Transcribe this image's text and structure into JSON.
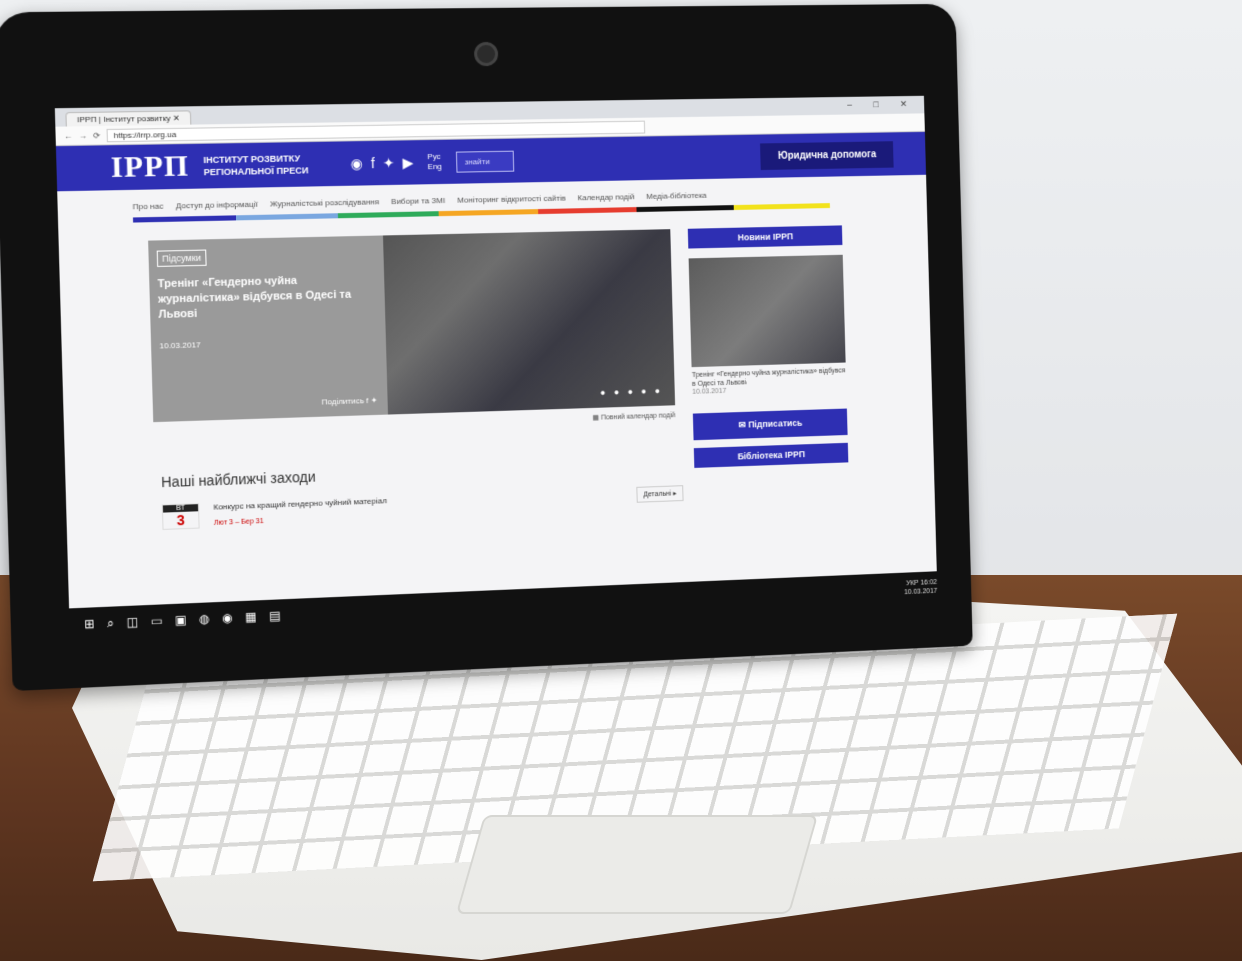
{
  "browser": {
    "tab_title": "ІРРП | Інститут розвитку",
    "url": "https://irrp.org.ua",
    "window_controls": "– □ ✕"
  },
  "header": {
    "logo": "ІРРП",
    "logo_text": "ІНСТИТУТ РОЗВИТКУ РЕГІОНАЛЬНОЇ ПРЕСИ",
    "lang_ru": "Рус",
    "lang_en": "Eng",
    "search_placeholder": "знайти",
    "legal_button": "Юридична допомога"
  },
  "nav": {
    "items": [
      "Про нас",
      "Доступ до інформації",
      "Журналістські розслідування",
      "Вибори та ЗМІ",
      "Моніторинг відкритості сайтів",
      "Календар подій",
      "Медіа-бібліотека"
    ],
    "colors": [
      "#2e2fb3",
      "#7aa7e0",
      "#2eab5a",
      "#f5a623",
      "#e63c2f",
      "#111111",
      "#f2e21c"
    ]
  },
  "slide": {
    "badge": "Підсумки",
    "title": "Тренінг «Гендерно чуйна журналістика» відбувся в Одесі та Львові",
    "date": "10.03.2017",
    "share": "Поділитись",
    "dots": "● ● ● ● ●"
  },
  "calendar_link": "Повний календар подій",
  "sidebar": {
    "news_button": "Новини ІРРП",
    "news_caption": "Тренінг «Гендерно чуйна журналістика» відбувся в Одесі та Львові",
    "news_date": "10.03.2017",
    "subscribe_button": "Підписатись",
    "library_button": "Бібліотека ІРРП"
  },
  "events": {
    "heading": "Наші найближчі заходи",
    "items": [
      {
        "weekday": "ВТ",
        "day": "3",
        "title": "Конкурс на кращий гендерно чуйний матеріал",
        "dates": "Лют 3 – Бер 31",
        "more": "Детальні ▸"
      }
    ]
  },
  "taskbar": {
    "time": "16:02",
    "date": "10.03.2017",
    "lang": "УКР"
  }
}
